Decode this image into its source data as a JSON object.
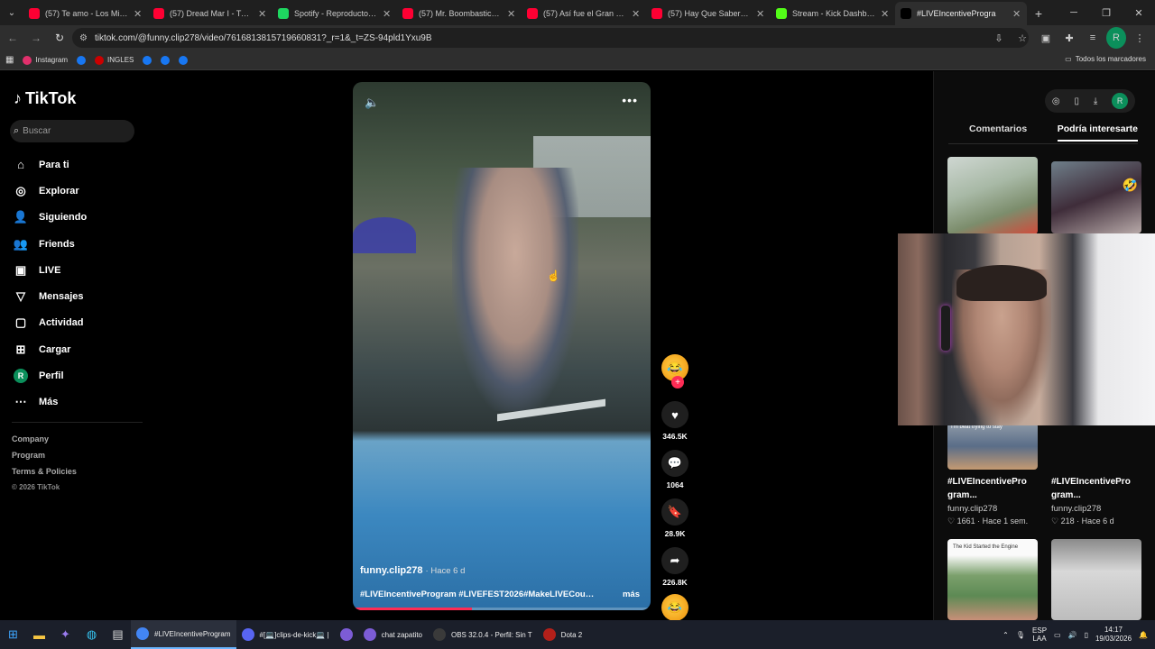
{
  "browser": {
    "tabs": [
      {
        "label": "(57) Te amo - Los Mier (Li",
        "color": "#ff0033"
      },
      {
        "label": "(57) Dread Mar I - Tu Sin",
        "color": "#ff0033"
      },
      {
        "label": "Spotify - Reproductor wel",
        "color": "#1ed760"
      },
      {
        "label": "(57) Mr. Boombastic Offic",
        "color": "#ff0033"
      },
      {
        "label": "(57) Así fue el Gran Regre",
        "color": "#ff0033"
      },
      {
        "label": "(57) Hay Que Saber Perde",
        "color": "#ff0033"
      },
      {
        "label": "Stream - Kick Dashboard",
        "color": "#53fc18"
      },
      {
        "label": "#LIVEIncentiveProgra",
        "color": "#000000"
      }
    ],
    "url": "tiktok.com/@funny.clip278/video/7616813815719660831?_r=1&_t=ZS-94pld1Yxu9B",
    "profile_initial": "R",
    "bookmarks": [
      {
        "label": "Instagram",
        "color": "#e1306c"
      },
      {
        "label": "",
        "color": "#1877f2"
      },
      {
        "label": "INGLES",
        "color": "#cc0000"
      },
      {
        "label": "",
        "color": "#1877f2"
      },
      {
        "label": "",
        "color": "#1877f2"
      },
      {
        "label": "",
        "color": "#1877f2"
      }
    ],
    "all_bookmarks": "Todos los marcadores"
  },
  "sidebar": {
    "logo": "TikTok",
    "search_placeholder": "Buscar",
    "items": [
      {
        "label": "Para ti",
        "icon": "home-icon"
      },
      {
        "label": "Explorar",
        "icon": "compass-icon"
      },
      {
        "label": "Siguiendo",
        "icon": "following-icon"
      },
      {
        "label": "Friends",
        "icon": "friends-icon"
      },
      {
        "label": "LIVE",
        "icon": "live-icon"
      },
      {
        "label": "Mensajes",
        "icon": "messages-icon"
      },
      {
        "label": "Actividad",
        "icon": "activity-icon"
      },
      {
        "label": "Cargar",
        "icon": "upload-icon"
      },
      {
        "label": "Perfil",
        "icon": "profile-avatar"
      },
      {
        "label": "Más",
        "icon": "more-icon"
      }
    ],
    "profile_initial": "R",
    "footer": {
      "company": "Company",
      "program": "Program",
      "terms": "Terms & Policies",
      "copyright": "© 2026 TikTok"
    }
  },
  "video": {
    "author": "funny.clip278",
    "age": "· Hace 6 d",
    "description": "#LIVEIncentiveProgram #LIVEFEST2026#MakeLIVECount...",
    "more_label": "más",
    "progress": 0.4
  },
  "actions": {
    "likes": "346.5K",
    "comments": "1064",
    "saves": "28.9K",
    "shares": "226.8K"
  },
  "right_panel": {
    "profile_initial": "R",
    "tab_comments": "Comentarios",
    "tab_interest": "Podría interesarte",
    "thumb_overlay_1": "I'm beat trying to stay",
    "thumb_overlay_2": "The Kid Started the Engine",
    "cards": [
      {
        "title": "#LIVEIncentivePro gram...",
        "user": "funny.clip278",
        "likes": "1661",
        "age": "Hace 1 sem."
      },
      {
        "title": "#LIVEIncentivePro gram...",
        "user": "funny.clip278",
        "likes": "218",
        "age": "Hace 6 d"
      }
    ]
  },
  "taskbar": {
    "apps": [
      {
        "label": "#LIVEIncentiveProgram",
        "color": "#4285f4",
        "active": true
      },
      {
        "label": "#[💻]clips-de-kick💻 |",
        "color": "#5865f2",
        "active": false
      },
      {
        "label": "",
        "color": "#7c5cd6",
        "active": false
      },
      {
        "label": "chat zapatito",
        "color": "#7c5cd6",
        "active": false
      },
      {
        "label": "OBS 32.0.4 - Perfil: Sin T",
        "color": "#3a3a3a",
        "active": false
      },
      {
        "label": "Dota 2",
        "color": "#b3201a",
        "active": false
      }
    ],
    "lang_top": "ESP",
    "lang_bottom": "LAA",
    "time": "14:17",
    "date": "19/03/2026"
  }
}
